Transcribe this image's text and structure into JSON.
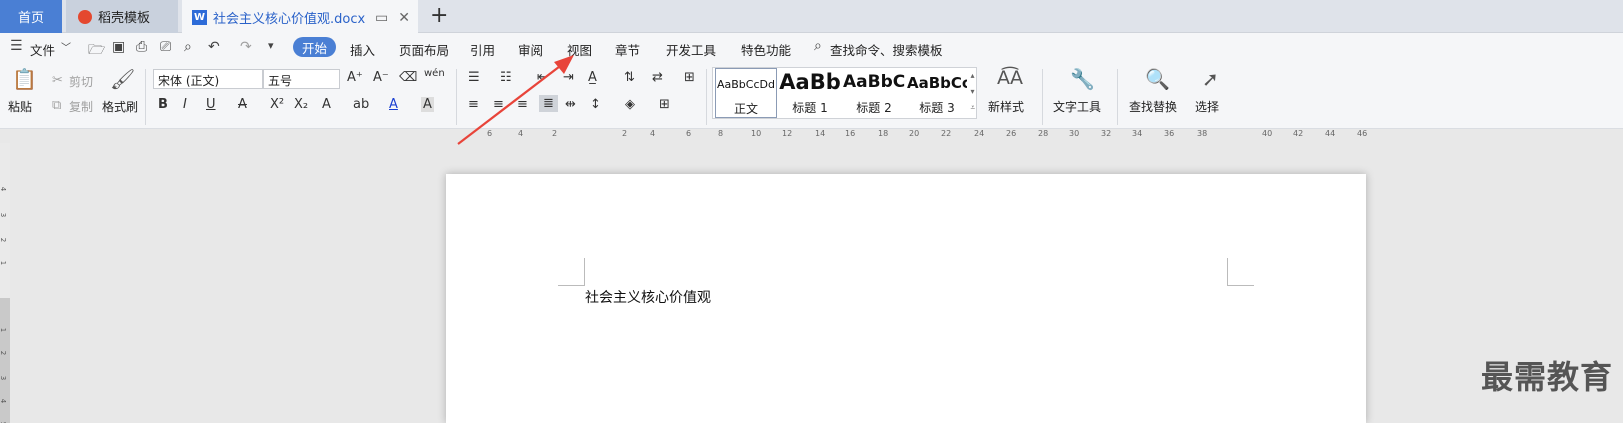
{
  "tabs": {
    "home": "首页",
    "template": "稻壳模板",
    "document": "社会主义核心价值观.docx",
    "doc_icon": "W"
  },
  "menu": {
    "file": "文件",
    "items": [
      "开始",
      "插入",
      "页面布局",
      "引用",
      "审阅",
      "视图",
      "章节",
      "开发工具",
      "特色功能"
    ],
    "search": "查找命令、搜索模板"
  },
  "ribbon": {
    "paste": "粘贴",
    "cut": "剪切",
    "copy": "复制",
    "format_painter": "格式刷",
    "font_name": "宋体 (正文)",
    "font_size": "五号",
    "styles": [
      {
        "preview": "AaBbCcDd",
        "label": "正文"
      },
      {
        "preview": "AaBb",
        "label": "标题 1"
      },
      {
        "preview": "AaBbC",
        "label": "标题 2"
      },
      {
        "preview": "AaBbCc",
        "label": "标题 3"
      }
    ],
    "new_style": "新样式",
    "text_tools": "文字工具",
    "find_replace": "查找替换",
    "select": "选择"
  },
  "ruler": {
    "labels": [
      "6",
      "4",
      "2",
      "2",
      "4",
      "6",
      "8",
      "10",
      "12",
      "14",
      "16",
      "18",
      "20",
      "22",
      "24",
      "26",
      "28",
      "30",
      "32",
      "34",
      "36",
      "38",
      "40",
      "42",
      "44",
      "46"
    ]
  },
  "vruler": {
    "labels": [
      "4",
      "3",
      "2",
      "1",
      "1",
      "2",
      "3",
      "4",
      "5"
    ]
  },
  "document": {
    "text": "社会主义核心价值观"
  },
  "watermark": "最需教育",
  "colors": {
    "accent": "#4a7fd4",
    "arrow": "#e8443a"
  }
}
